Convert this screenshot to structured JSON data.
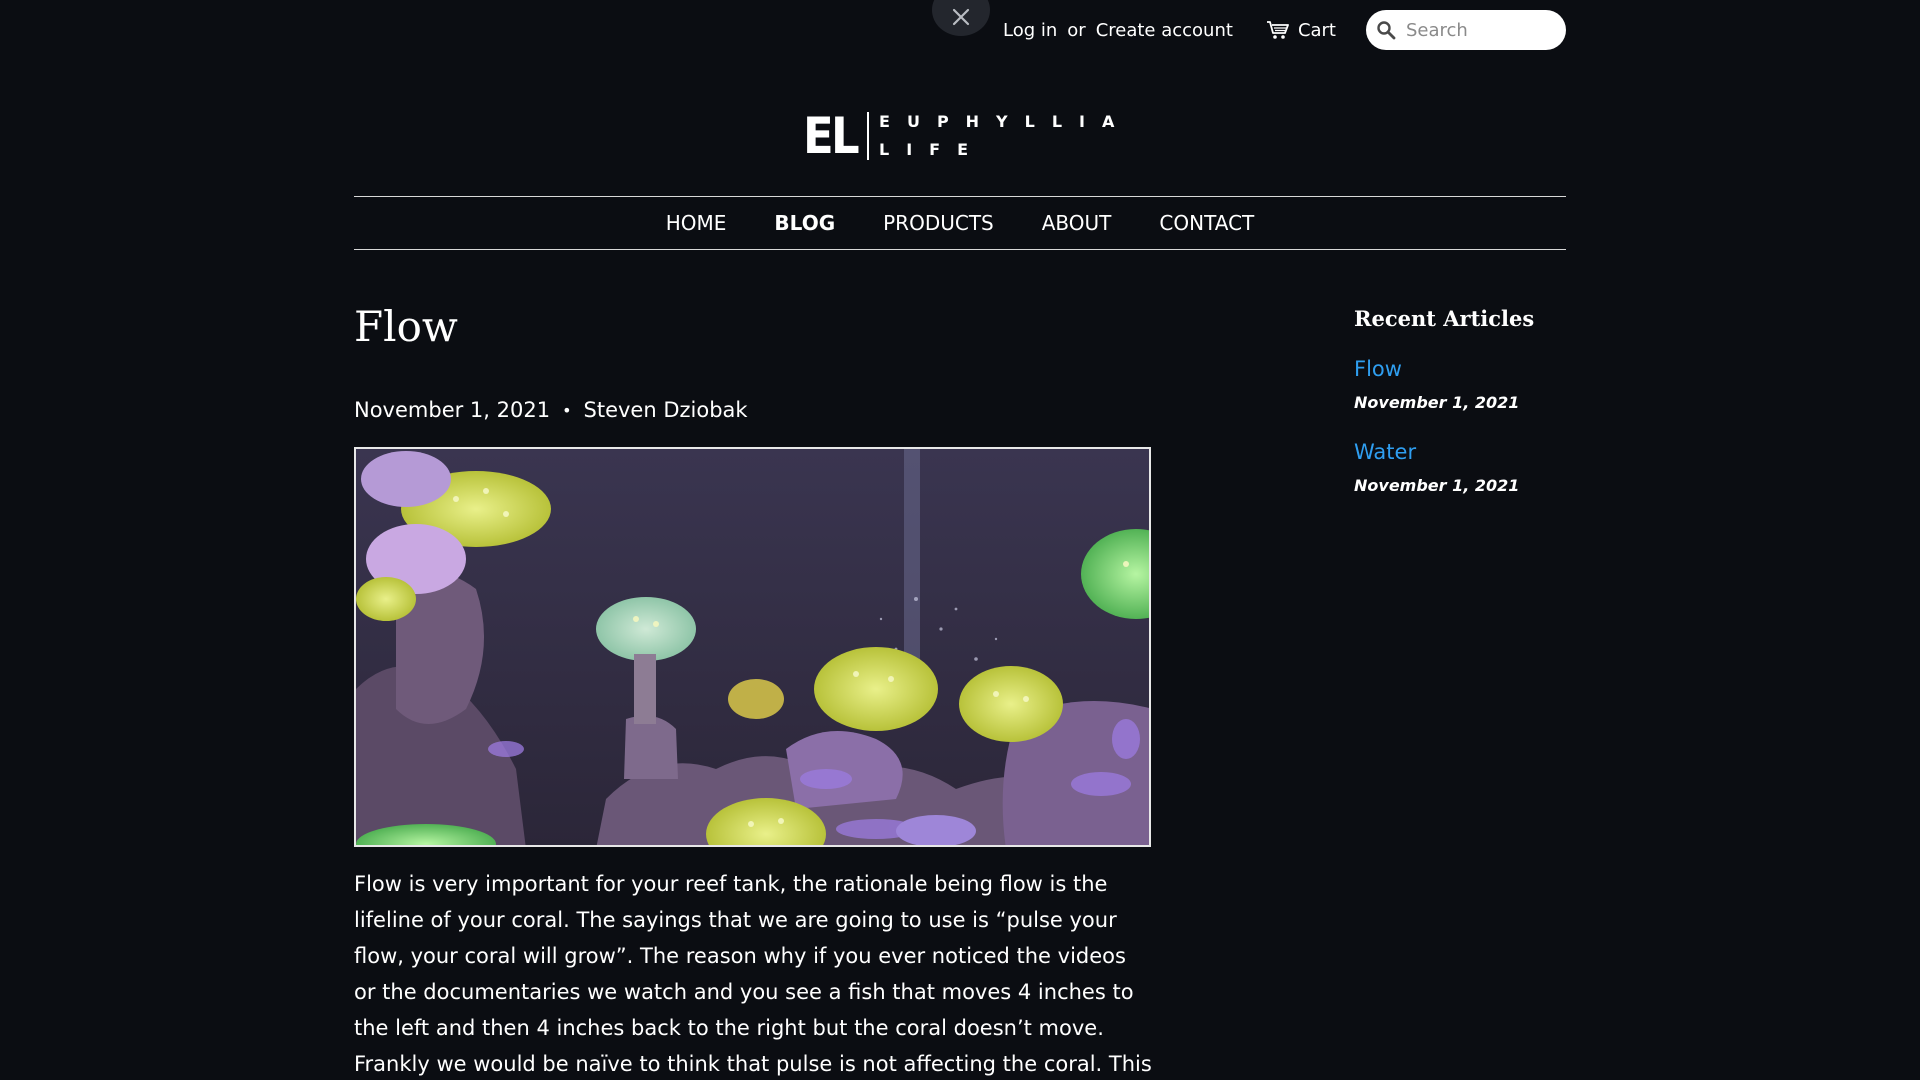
{
  "header": {
    "login_label": "Log in",
    "or_label": "or",
    "create_account_label": "Create account",
    "cart_label": "Cart",
    "search_placeholder": "Search"
  },
  "logo": {
    "mark": "EL",
    "line1": "EUPHYLLIA",
    "line2": "LIFE"
  },
  "nav": {
    "items": [
      {
        "label": "HOME",
        "active": false
      },
      {
        "label": "BLOG",
        "active": true
      },
      {
        "label": "PRODUCTS",
        "active": false
      },
      {
        "label": "ABOUT",
        "active": false
      },
      {
        "label": "CONTACT",
        "active": false
      }
    ]
  },
  "article": {
    "title": "Flow",
    "date": "November 1, 2021",
    "separator": "•",
    "author": "Steven Dziobak",
    "body": "Flow is very important for your reef tank, the rationale being flow is the lifeline of your coral. The sayings that we are going to use is “pulse your flow, your coral will grow”. The reason why if you ever noticed the videos or the documentaries we watch and you see a fish that moves 4 inches to the left and then 4 inches back to the right but the coral doesn’t move. Frankly we would be naïve to think that pulse is not affecting the coral. This is the reasoning for pulse your flow,"
  },
  "sidebar": {
    "heading": "Recent Articles",
    "articles": [
      {
        "title": "Flow",
        "date": "November 1, 2021"
      },
      {
        "title": "Water",
        "date": "November 1, 2021"
      }
    ]
  },
  "colors": {
    "background": "#0b0d12",
    "link": "#2f9ef0",
    "text": "#ffffff"
  },
  "icons": {
    "close": "close-icon",
    "cart": "cart-icon",
    "search": "search-icon"
  }
}
